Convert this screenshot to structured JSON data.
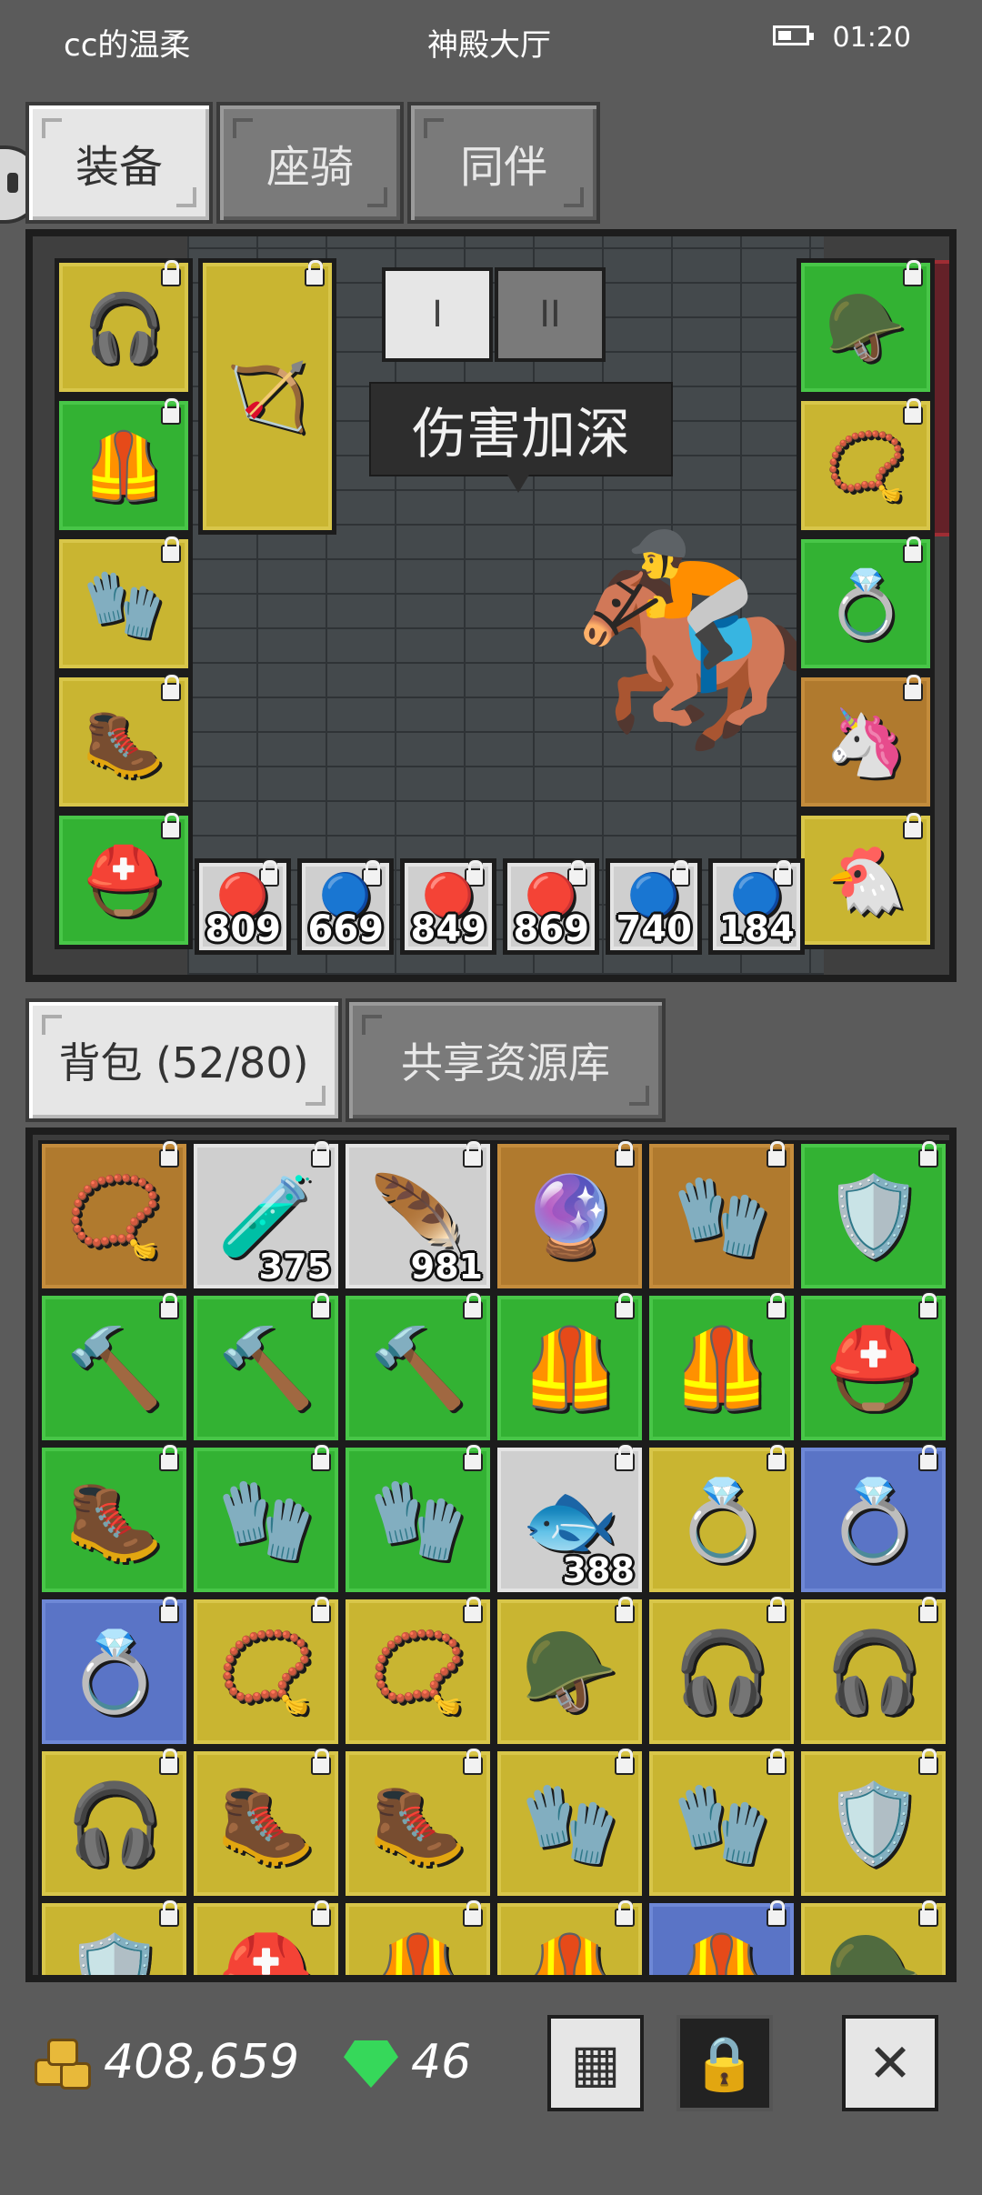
{
  "status_bar": {
    "user": "cc的温柔",
    "location": "神殿大厅",
    "time": "01:20"
  },
  "equip_tabs": [
    "装备",
    "座骑",
    "同伴"
  ],
  "equip_tab_active": 0,
  "page_buttons": [
    "I",
    "II"
  ],
  "tooltip": "伤害加深",
  "left_slots": [
    {
      "icon": "headphones-necklace-icon",
      "emoji": "🎧",
      "rarity": "y"
    },
    {
      "icon": "dark-armor-icon",
      "emoji": "🦺",
      "rarity": "g"
    },
    {
      "icon": "gauntlet-icon",
      "emoji": "🧤",
      "rarity": "y"
    },
    {
      "icon": "boots-icon",
      "emoji": "🥾",
      "rarity": "y"
    },
    {
      "icon": "helmet-icon",
      "emoji": "⛑️",
      "rarity": "g"
    }
  ],
  "weapon_slot": {
    "icon": "bow-icon",
    "emoji": "🏹",
    "rarity": "y"
  },
  "right_slots": [
    {
      "icon": "horned-helmet-icon",
      "emoji": "🪖",
      "rarity": "g"
    },
    {
      "icon": "amulet-purple-icon",
      "emoji": "📿",
      "rarity": "y"
    },
    {
      "icon": "amulet-green-icon",
      "emoji": "💍",
      "rarity": "g"
    },
    {
      "icon": "unicorn-mount-icon",
      "emoji": "🦄",
      "rarity": "o"
    },
    {
      "icon": "chicken-companion-icon",
      "emoji": "🐔",
      "rarity": "y"
    }
  ],
  "gem_slots": [
    {
      "icon": "red-gem-icon",
      "emoji": "🔴",
      "count": "809"
    },
    {
      "icon": "blue-gem-icon",
      "emoji": "🔵",
      "count": "669"
    },
    {
      "icon": "red-gem-icon",
      "emoji": "🔴",
      "count": "849"
    },
    {
      "icon": "red-gem-icon",
      "emoji": "🔴",
      "count": "869"
    },
    {
      "icon": "blue-gem-icon",
      "emoji": "🔵",
      "count": "740"
    },
    {
      "icon": "blue-gem-icon",
      "emoji": "🔵",
      "count": "184"
    }
  ],
  "hero": {
    "icon": "hero-on-mount-icon",
    "emoji": "🏇"
  },
  "bag_tabs": [
    "背包 (52/80)",
    "共享资源库"
  ],
  "bag_items": [
    {
      "icon": "ruby-amulet-icon",
      "emoji": "📿",
      "rarity": "o",
      "count": ""
    },
    {
      "icon": "health-potion-icon",
      "emoji": "🧪",
      "rarity": "w",
      "count": "375"
    },
    {
      "icon": "red-feather-icon",
      "emoji": "🪶",
      "rarity": "w",
      "count": "981"
    },
    {
      "icon": "blue-orb-icon",
      "emoji": "🔮",
      "rarity": "o",
      "count": ""
    },
    {
      "icon": "dark-glove-icon",
      "emoji": "🧤",
      "rarity": "o",
      "count": ""
    },
    {
      "icon": "shield-icon",
      "emoji": "🛡️",
      "rarity": "g",
      "count": ""
    },
    {
      "icon": "mace-icon",
      "emoji": "🔨",
      "rarity": "g",
      "count": ""
    },
    {
      "icon": "mace-icon",
      "emoji": "🔨",
      "rarity": "g",
      "count": ""
    },
    {
      "icon": "mace-icon",
      "emoji": "🔨",
      "rarity": "g",
      "count": ""
    },
    {
      "icon": "dark-armor-icon",
      "emoji": "🦺",
      "rarity": "g",
      "count": ""
    },
    {
      "icon": "dark-armor-icon",
      "emoji": "🦺",
      "rarity": "g",
      "count": ""
    },
    {
      "icon": "dark-helmet-icon",
      "emoji": "⛑️",
      "rarity": "g",
      "count": ""
    },
    {
      "icon": "boots-icon",
      "emoji": "🥾",
      "rarity": "g",
      "count": ""
    },
    {
      "icon": "gauntlet-icon",
      "emoji": "🧤",
      "rarity": "g",
      "count": ""
    },
    {
      "icon": "blue-gauntlet-icon",
      "emoji": "🧤",
      "rarity": "g",
      "count": ""
    },
    {
      "icon": "fish-icon",
      "emoji": "🐟",
      "rarity": "w",
      "count": "388"
    },
    {
      "icon": "ring-icon",
      "emoji": "💍",
      "rarity": "y",
      "count": ""
    },
    {
      "icon": "gold-ring-icon",
      "emoji": "💍",
      "rarity": "b",
      "count": ""
    },
    {
      "icon": "gold-ring-icon",
      "emoji": "💍",
      "rarity": "b",
      "count": ""
    },
    {
      "icon": "ruby-amulet-icon",
      "emoji": "📿",
      "rarity": "y",
      "count": ""
    },
    {
      "icon": "emerald-amulet-icon",
      "emoji": "📿",
      "rarity": "y",
      "count": ""
    },
    {
      "icon": "horned-helmet-icon",
      "emoji": "🪖",
      "rarity": "y",
      "count": ""
    },
    {
      "icon": "headphones-necklace-icon",
      "emoji": "🎧",
      "rarity": "y",
      "count": ""
    },
    {
      "icon": "headphones-necklace-icon",
      "emoji": "🎧",
      "rarity": "y",
      "count": ""
    },
    {
      "icon": "headphones-necklace-icon",
      "emoji": "🎧",
      "rarity": "y",
      "count": ""
    },
    {
      "icon": "boots-icon",
      "emoji": "🥾",
      "rarity": "y",
      "count": ""
    },
    {
      "icon": "boots-icon",
      "emoji": "🥾",
      "rarity": "y",
      "count": ""
    },
    {
      "icon": "leather-glove-icon",
      "emoji": "🧤",
      "rarity": "y",
      "count": ""
    },
    {
      "icon": "leather-glove-icon",
      "emoji": "🧤",
      "rarity": "y",
      "count": ""
    },
    {
      "icon": "wooden-shield-icon",
      "emoji": "🛡️",
      "rarity": "y",
      "count": ""
    },
    {
      "icon": "wooden-shield-icon",
      "emoji": "🛡️",
      "rarity": "y",
      "count": ""
    },
    {
      "icon": "gold-helmet-icon",
      "emoji": "⛑️",
      "rarity": "y",
      "count": ""
    },
    {
      "icon": "leather-armor-icon",
      "emoji": "🦺",
      "rarity": "y",
      "count": ""
    },
    {
      "icon": "chain-armor-icon",
      "emoji": "🦺",
      "rarity": "y",
      "count": ""
    },
    {
      "icon": "dark-armor-icon",
      "emoji": "🦺",
      "rarity": "b",
      "count": ""
    },
    {
      "icon": "horned-helmet-icon",
      "emoji": "🪖",
      "rarity": "y",
      "count": ""
    }
  ],
  "footer": {
    "gold": "408,659",
    "gems": "46",
    "buttons": [
      {
        "icon": "grid-sort-icon",
        "glyph": "▦"
      },
      {
        "icon": "lock-icon",
        "glyph": "🔒"
      },
      {
        "icon": "close-icon",
        "glyph": "✕"
      }
    ]
  }
}
